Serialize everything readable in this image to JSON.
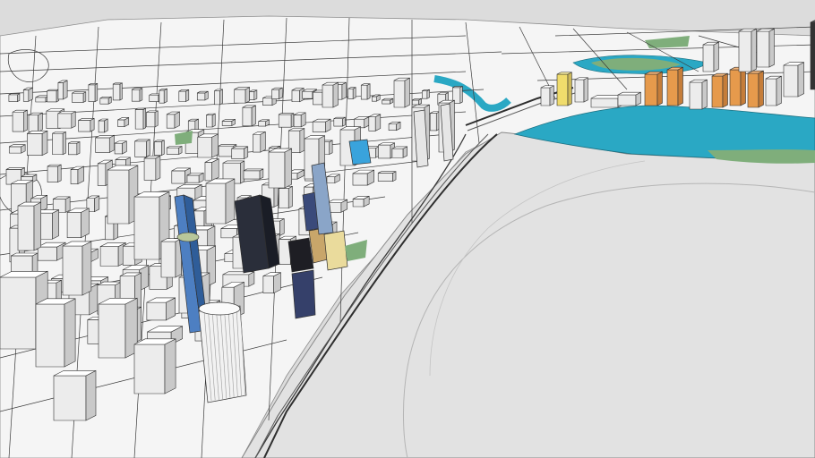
{
  "scene": {
    "kind": "3d-city-model-view",
    "colors": {
      "sky": "#dcdcdc",
      "river": "#e2e2e2",
      "river_edge": "#9a9a9a",
      "ground": "#f7f7f7",
      "road_line": "#3a3a3a",
      "building_top": "#ffffff",
      "building_left": "#ececec",
      "building_right": "#c9c9c9",
      "building_edge": "#303030",
      "water_teal": "#2aa8c4",
      "park_green": "#7fae7b",
      "accent_orange": "#e69a4c",
      "accent_yellow": "#f0dc6c",
      "glass_blue": "#4d7fc2",
      "tower_dark": "#2a2e3a",
      "tower_gold": "#c8a66a"
    }
  }
}
